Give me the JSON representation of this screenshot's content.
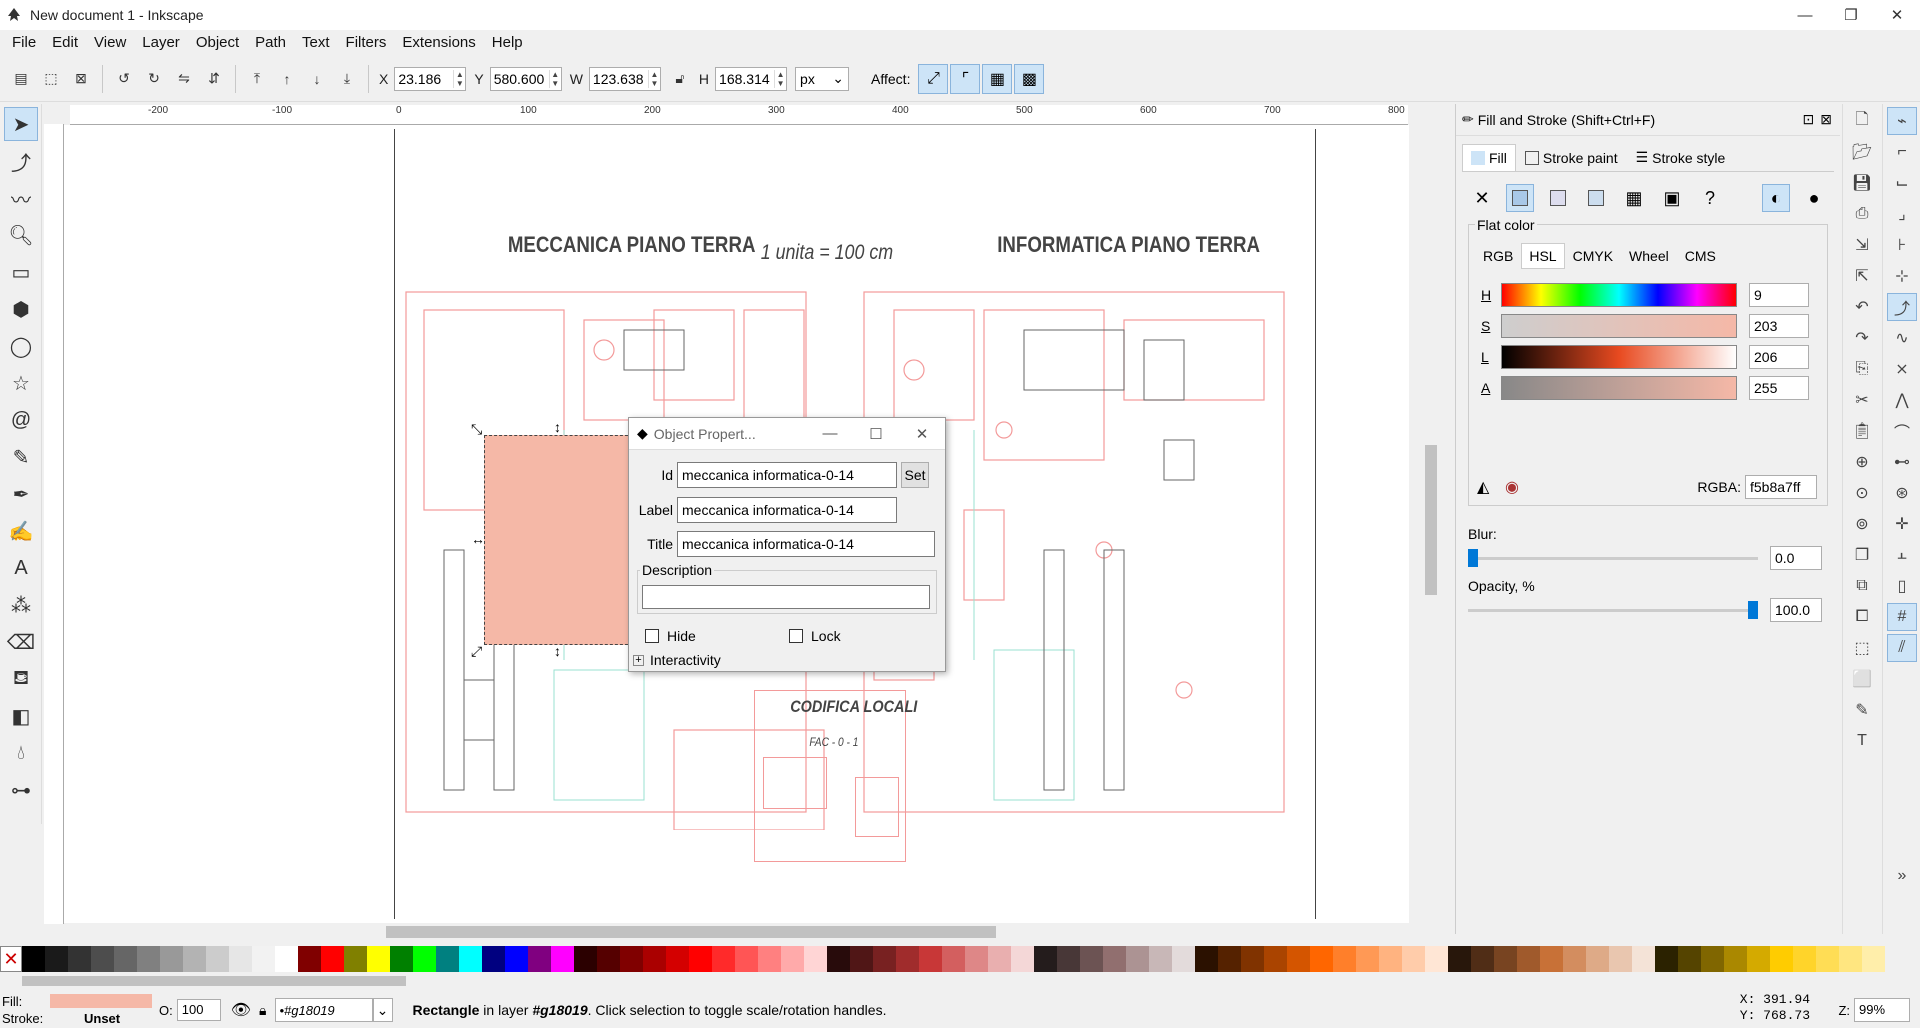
{
  "window": {
    "title": "New document 1 - Inkscape",
    "min": "—",
    "max": "❐",
    "close": "✕"
  },
  "menu": [
    "File",
    "Edit",
    "View",
    "Layer",
    "Object",
    "Path",
    "Text",
    "Filters",
    "Extensions",
    "Help"
  ],
  "toolbar": {
    "x_label": "X",
    "x_value": "23.186",
    "y_label": "Y",
    "y_value": "580.600",
    "w_label": "W",
    "w_value": "123.638",
    "h_label": "H",
    "h_value": "168.314",
    "unit": "px",
    "affect_label": "Affect:"
  },
  "ruler": {
    "h_ticks": [
      "-200",
      "-100",
      "0",
      "100",
      "200",
      "300",
      "400",
      "500",
      "600",
      "700",
      "800"
    ]
  },
  "canvas": {
    "heading_left": "MECCANICA PIANO TERRA",
    "heading_scale": "1 unita = 100 cm",
    "heading_right": "INFORMATICA PIANO TERRA",
    "legend_title": "CODIFICA LOCALI",
    "legend_code": "FAC - 0 - 1",
    "selected_fill": "#f5b8a7"
  },
  "object_properties": {
    "title": "Object Propert...",
    "id_label": "Id",
    "id_value": "meccanica informatica-0-14",
    "set_label": "Set",
    "label_label": "Label",
    "label_value": "meccanica informatica-0-14",
    "title_label": "Title",
    "title_value": "meccanica informatica-0-14",
    "description_label": "Description",
    "hide_label": "Hide",
    "lock_label": "Lock",
    "interactivity_label": "Interactivity"
  },
  "fill_stroke": {
    "title": "Fill and Stroke (Shift+Ctrl+F)",
    "tabs": [
      "Fill",
      "Stroke paint",
      "Stroke style"
    ],
    "flat_color_label": "Flat color",
    "color_tabs": [
      "RGB",
      "HSL",
      "CMYK",
      "Wheel",
      "CMS"
    ],
    "h_label": "H",
    "h_value": "9",
    "s_label": "S",
    "s_value": "203",
    "l_label": "L",
    "l_value": "206",
    "a_label": "A",
    "a_value": "255",
    "rgba_label": "RGBA:",
    "rgba_value": "f5b8a7ff",
    "blur_label": "Blur:",
    "blur_value": "0.0",
    "opacity_label": "Opacity, %",
    "opacity_value": "100.0"
  },
  "status": {
    "fill_label": "Fill:",
    "stroke_label": "Stroke:",
    "stroke_value": "Unset",
    "opacity_label": "O:",
    "opacity_value": "100",
    "layer": "•#g18019",
    "msg_obj": "Rectangle",
    "msg_mid": " in layer ",
    "msg_layer": "#g18019",
    "msg_end": ". Click selection to toggle scale/rotation handles.",
    "x_readout": "X:  391.94",
    "y_readout": "Y:  768.73",
    "zoom_label": "Z:",
    "zoom_value": "99%"
  },
  "palette_colors": [
    "#000000",
    "#1a1a1a",
    "#333333",
    "#4d4d4d",
    "#666666",
    "#808080",
    "#999999",
    "#b3b3b3",
    "#cccccc",
    "#e6e6e6",
    "#f2f2f2",
    "#ffffff",
    "#800000",
    "#ff0000",
    "#808000",
    "#ffff00",
    "#008000",
    "#00ff00",
    "#008080",
    "#00ffff",
    "#000080",
    "#0000ff",
    "#800080",
    "#ff00ff",
    "#2b0000",
    "#550000",
    "#800000",
    "#aa0000",
    "#d40000",
    "#ff0000",
    "#ff2a2a",
    "#ff5555",
    "#ff8080",
    "#ffaaaa",
    "#ffd5d5",
    "#280b0b",
    "#501616",
    "#782121",
    "#a02c2c",
    "#c83737",
    "#d35f5f",
    "#de8787",
    "#e9afaf",
    "#f4d7d7",
    "#241c1c",
    "#483737",
    "#6c5353",
    "#916f6f",
    "#ac9393",
    "#c8b7b7",
    "#e3dbdb",
    "#2b1100",
    "#552200",
    "#803300",
    "#aa4400",
    "#d45500",
    "#ff6600",
    "#ff7f2a",
    "#ff9955",
    "#ffb380",
    "#ffccaa",
    "#ffe6d5",
    "#28170b",
    "#502d16",
    "#784421",
    "#a05a2c",
    "#c87137",
    "#d38d5f",
    "#deaa87",
    "#e9c6af",
    "#f4e3d7",
    "#2b2200",
    "#554400",
    "#806600",
    "#aa8800",
    "#d4aa00",
    "#ffcc00",
    "#ffd42a",
    "#ffdd55",
    "#ffe680",
    "#ffeeaa"
  ]
}
